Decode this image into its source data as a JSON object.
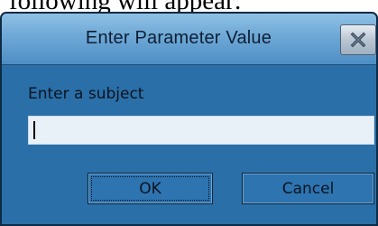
{
  "document": {
    "fragment_text": "following will appear:"
  },
  "dialog": {
    "title": "Enter Parameter Value",
    "close_icon": "close-x-icon",
    "prompt_label": "Enter a subject",
    "input_value": "",
    "buttons": {
      "ok_label": "OK",
      "cancel_label": "Cancel"
    }
  },
  "colors": {
    "dialog_body": "#2a6fa8",
    "titlebar_top": "#8fc0e4",
    "titlebar_bottom": "#4f8ec4",
    "input_background": "#e9f1f8"
  }
}
